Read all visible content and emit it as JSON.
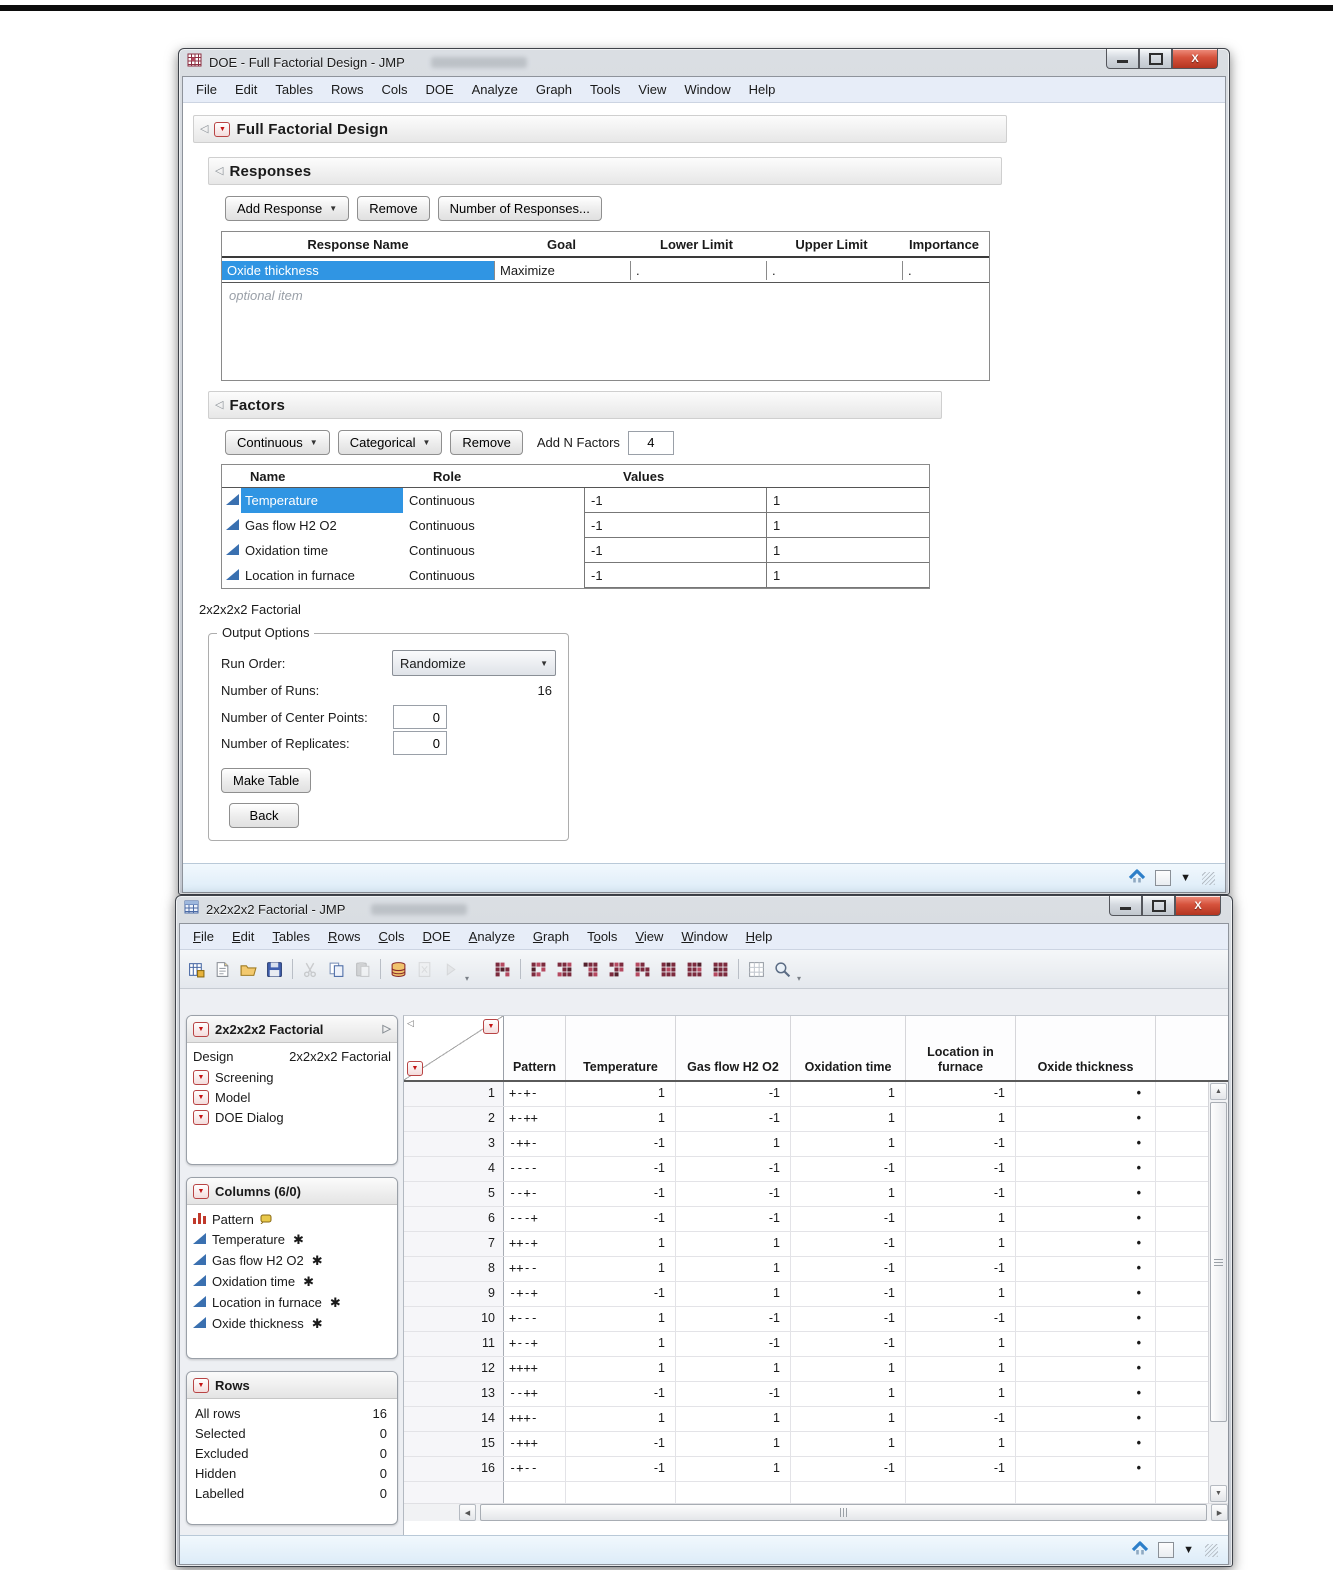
{
  "window1": {
    "title": "DOE - Full Factorial Design - JMP",
    "menu": [
      "File",
      "Edit",
      "Tables",
      "Rows",
      "Cols",
      "DOE",
      "Analyze",
      "Graph",
      "Tools",
      "View",
      "Window",
      "Help"
    ],
    "outline_title": "Full Factorial Design",
    "responses": {
      "title": "Responses",
      "add_button": "Add Response",
      "remove_button": "Remove",
      "number_button": "Number of Responses...",
      "headers": [
        "Response Name",
        "Goal",
        "Lower Limit",
        "Upper Limit",
        "Importance"
      ],
      "row": {
        "name": "Oxide thickness",
        "goal": "Maximize",
        "lower": ".",
        "upper": ".",
        "importance": "."
      },
      "placeholder": "optional item"
    },
    "factors": {
      "title": "Factors",
      "continuous_button": "Continuous",
      "categorical_button": "Categorical",
      "remove_button": "Remove",
      "add_n_label": "Add N Factors",
      "add_n_value": "4",
      "headers": [
        "Name",
        "Role",
        "Values"
      ],
      "rows": [
        {
          "name": "Temperature",
          "role": "Continuous",
          "low": "-1",
          "high": "1",
          "selected": true
        },
        {
          "name": "Gas flow H2 O2",
          "role": "Continuous",
          "low": "-1",
          "high": "1",
          "selected": false
        },
        {
          "name": "Oxidation time",
          "role": "Continuous",
          "low": "-1",
          "high": "1",
          "selected": false
        },
        {
          "name": "Location in furnace",
          "role": "Continuous",
          "low": "-1",
          "high": "1",
          "selected": false
        }
      ]
    },
    "design_label": "2x2x2x2 Factorial",
    "output": {
      "title": "Output Options",
      "run_order_label": "Run Order:",
      "run_order_value": "Randomize",
      "runs_label": "Number of Runs:",
      "runs_value": "16",
      "center_label": "Number of Center Points:",
      "center_value": "0",
      "replicates_label": "Number of Replicates:",
      "replicates_value": "0",
      "make_table_button": "Make Table",
      "back_button": "Back"
    }
  },
  "window2": {
    "title": "2x2x2x2 Factorial - JMP",
    "menu": [
      {
        "label": "File",
        "u": 0
      },
      {
        "label": "Edit",
        "u": 0
      },
      {
        "label": "Tables",
        "u": 0
      },
      {
        "label": "Rows",
        "u": 0
      },
      {
        "label": "Cols",
        "u": 0
      },
      {
        "label": "DOE",
        "u": 0
      },
      {
        "label": "Analyze",
        "u": 0
      },
      {
        "label": "Graph",
        "u": 0
      },
      {
        "label": "Tools",
        "u": 1
      },
      {
        "label": "View",
        "u": 0
      },
      {
        "label": "Window",
        "u": 0
      },
      {
        "label": "Help",
        "u": 0
      }
    ],
    "toolbar": [
      {
        "icon": "new-table",
        "name": "new-data-table-icon"
      },
      {
        "icon": "new-journal",
        "name": "new-journal-icon"
      },
      {
        "icon": "open",
        "name": "open-icon"
      },
      {
        "icon": "save",
        "name": "save-icon"
      },
      {
        "sep": true
      },
      {
        "icon": "cut",
        "name": "cut-icon",
        "dim": true
      },
      {
        "icon": "copy",
        "name": "copy-icon"
      },
      {
        "icon": "paste",
        "name": "paste-icon",
        "dim": true
      },
      {
        "sep": true
      },
      {
        "icon": "database",
        "name": "database-icon"
      },
      {
        "icon": "excel-import",
        "name": "import-icon",
        "dim": true
      },
      {
        "icon": "run-script",
        "name": "run-script-icon",
        "dim": true
      },
      {
        "overflow": true
      },
      {
        "gap": true
      },
      {
        "icon": "design",
        "pattern": "rl.rdrr.l",
        "name": "design-icon-1"
      },
      {
        "sep": true
      },
      {
        "icon": "design",
        "pattern": "rlrd.lrl.",
        "name": "design-icon-2"
      },
      {
        "icon": "design",
        "pattern": "rrl.rdlrr",
        "name": "design-icon-3"
      },
      {
        "icon": "design",
        "pattern": "drr.lr.rl",
        "name": "design-icon-4"
      },
      {
        "icon": "design",
        "pattern": "rlr.rlrd.",
        "name": "design-icon-5"
      },
      {
        "icon": "design",
        "pattern": "lr.drrl.r",
        "name": "design-icon-6"
      },
      {
        "icon": "design",
        "pattern": "rdrrlrrrr",
        "name": "design-icon-7"
      },
      {
        "icon": "design",
        "pattern": "rrdrrlrrr",
        "name": "design-icon-8"
      },
      {
        "icon": "design",
        "pattern": "rrrdrrlrr",
        "name": "design-icon-9"
      },
      {
        "sep": true
      },
      {
        "icon": "grid-check",
        "name": "grid-icon"
      },
      {
        "icon": "search",
        "name": "preview-icon"
      },
      {
        "overflow": true
      }
    ],
    "sidebar": {
      "table_panel": {
        "title": "2x2x2x2 Factorial",
        "design_label": "Design",
        "design_value": "2x2x2x2 Factorial",
        "items": [
          "Screening",
          "Model",
          "DOE Dialog"
        ]
      },
      "columns_panel": {
        "title": "Columns (6/0)",
        "items": [
          {
            "label": "Pattern",
            "type": "nominal",
            "locked": true,
            "star": false
          },
          {
            "label": "Temperature",
            "type": "continuous",
            "locked": false,
            "star": true
          },
          {
            "label": "Gas flow H2 O2",
            "type": "continuous",
            "locked": false,
            "star": true
          },
          {
            "label": "Oxidation time",
            "type": "continuous",
            "locked": false,
            "star": true
          },
          {
            "label": "Location in furnace",
            "type": "continuous",
            "locked": false,
            "star": true
          },
          {
            "label": "Oxide thickness",
            "type": "continuous",
            "locked": false,
            "star": true
          }
        ]
      },
      "rows_panel": {
        "title": "Rows",
        "stats": [
          {
            "label": "All rows",
            "value": "16"
          },
          {
            "label": "Selected",
            "value": "0"
          },
          {
            "label": "Excluded",
            "value": "0"
          },
          {
            "label": "Hidden",
            "value": "0"
          },
          {
            "label": "Labelled",
            "value": "0"
          }
        ]
      }
    },
    "grid": {
      "headers": [
        "Pattern",
        "Temperature",
        "Gas flow H2 O2",
        "Oxidation time",
        "Location in furnace",
        "Oxide thickness"
      ],
      "missing_marker": "•",
      "rows": [
        {
          "n": "1",
          "pattern": "+-+-",
          "v": [
            "1",
            "-1",
            "1",
            "-1"
          ]
        },
        {
          "n": "2",
          "pattern": "+-++",
          "v": [
            "1",
            "-1",
            "1",
            "1"
          ]
        },
        {
          "n": "3",
          "pattern": "-++-",
          "v": [
            "-1",
            "1",
            "1",
            "-1"
          ]
        },
        {
          "n": "4",
          "pattern": "----",
          "v": [
            "-1",
            "-1",
            "-1",
            "-1"
          ]
        },
        {
          "n": "5",
          "pattern": "--+-",
          "v": [
            "-1",
            "-1",
            "1",
            "-1"
          ]
        },
        {
          "n": "6",
          "pattern": "---+",
          "v": [
            "-1",
            "-1",
            "-1",
            "1"
          ]
        },
        {
          "n": "7",
          "pattern": "++-+",
          "v": [
            "1",
            "1",
            "-1",
            "1"
          ]
        },
        {
          "n": "8",
          "pattern": "++--",
          "v": [
            "1",
            "1",
            "-1",
            "-1"
          ]
        },
        {
          "n": "9",
          "pattern": "-+-+",
          "v": [
            "-1",
            "1",
            "-1",
            "1"
          ]
        },
        {
          "n": "10",
          "pattern": "+---",
          "v": [
            "1",
            "-1",
            "-1",
            "-1"
          ]
        },
        {
          "n": "11",
          "pattern": "+--+",
          "v": [
            "1",
            "-1",
            "-1",
            "1"
          ]
        },
        {
          "n": "12",
          "pattern": "++++",
          "v": [
            "1",
            "1",
            "1",
            "1"
          ]
        },
        {
          "n": "13",
          "pattern": "--++",
          "v": [
            "-1",
            "-1",
            "1",
            "1"
          ]
        },
        {
          "n": "14",
          "pattern": "+++-",
          "v": [
            "1",
            "1",
            "1",
            "-1"
          ]
        },
        {
          "n": "15",
          "pattern": "-+++",
          "v": [
            "-1",
            "1",
            "1",
            "1"
          ]
        },
        {
          "n": "16",
          "pattern": "-+--",
          "v": [
            "-1",
            "1",
            "-1",
            "-1"
          ]
        }
      ]
    }
  },
  "colors": {
    "selection_blue": "#3095e3",
    "continuous_icon_blue": "#3a70b0",
    "nominal_icon_red": "#c0392b",
    "red_hotspot": "#c41414",
    "close_button_red": "#d6523c"
  }
}
